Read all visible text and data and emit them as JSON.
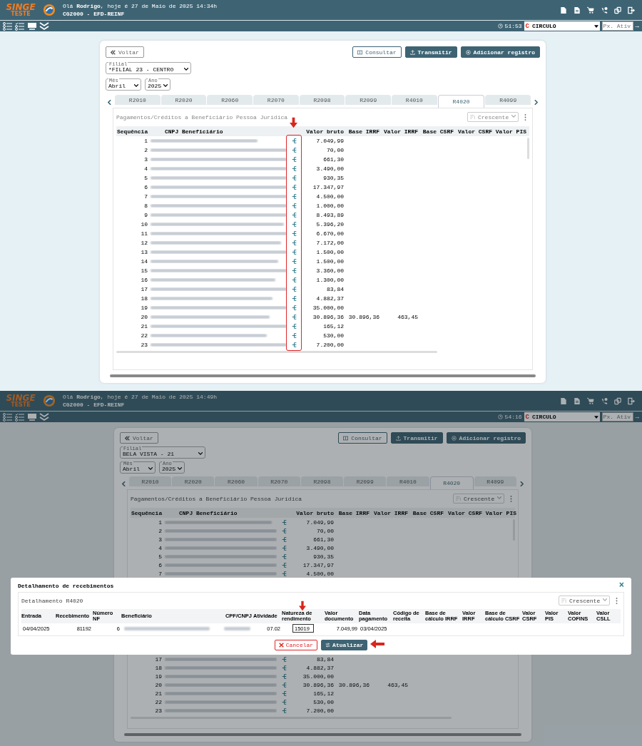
{
  "screens": [
    {
      "header": {
        "logo_top": "SINGE",
        "logo_bottom": "TESTE",
        "greeting": "Olá **Rodrigo**, hoje é 27 de Maio de 2025 14:34h",
        "module": "CG2000 - EFD-REINF"
      },
      "toolbar": {
        "session_time": "51:53",
        "company_logo": "C",
        "company": "CIRCULO",
        "field_placeholder": "Px. Ativ",
        "go": "→"
      },
      "back_button": "Voltar",
      "actions": [
        {
          "label": "Consultar",
          "kind": "outline"
        },
        {
          "label": "Transmitir",
          "kind": "upload"
        },
        {
          "label": "Adicionar registro",
          "kind": "add"
        }
      ],
      "filial": {
        "label": "Filial",
        "value": "*FILIAL 23 - CENTRO"
      },
      "mes": {
        "label": "Mês",
        "value": "Abril"
      },
      "ano": {
        "label": "Ano",
        "value": "2025"
      },
      "tabs": [
        {
          "label": "R2010",
          "selected": false
        },
        {
          "label": "R2020",
          "selected": false
        },
        {
          "label": "R2060",
          "selected": false
        },
        {
          "label": "R2070",
          "selected": false
        },
        {
          "label": "R2098",
          "selected": false
        },
        {
          "label": "R2099",
          "selected": false
        },
        {
          "label": "R4010",
          "selected": false
        },
        {
          "label": "R4020",
          "selected": true
        },
        {
          "label": "R4099",
          "selected": false
        }
      ],
      "panel": {
        "title": "Pagamentos/Créditos a Beneficiário Pessoa Jurídica",
        "sort": "Crescente",
        "columns": [
          "Sequência",
          "CNPJ Beneficiário",
          "Valor bruto",
          "Base IRRF",
          "Valor IRRF",
          "Base CSRF",
          "Valor CSRF",
          "Valor PIS"
        ],
        "rows": [
          {
            "seq": "1",
            "valor_bruto": "7.049,99"
          },
          {
            "seq": "2",
            "valor_bruto": "70,00"
          },
          {
            "seq": "3",
            "valor_bruto": "661,30"
          },
          {
            "seq": "4",
            "valor_bruto": "3.490,00"
          },
          {
            "seq": "5",
            "valor_bruto": "930,35"
          },
          {
            "seq": "6",
            "valor_bruto": "17.347,97"
          },
          {
            "seq": "7",
            "valor_bruto": "4.500,00"
          },
          {
            "seq": "8",
            "valor_bruto": "1.000,00"
          },
          {
            "seq": "9",
            "valor_bruto": "8.493,89"
          },
          {
            "seq": "10",
            "valor_bruto": "5.396,20"
          },
          {
            "seq": "11",
            "valor_bruto": "6.670,00"
          },
          {
            "seq": "12",
            "valor_bruto": "7.172,00"
          },
          {
            "seq": "13",
            "valor_bruto": "1.500,00"
          },
          {
            "seq": "14",
            "valor_bruto": "1.500,00"
          },
          {
            "seq": "15",
            "valor_bruto": "3.360,00"
          },
          {
            "seq": "16",
            "valor_bruto": "1.300,00"
          },
          {
            "seq": "17",
            "valor_bruto": "83,84"
          },
          {
            "seq": "18",
            "valor_bruto": "4.882,37"
          },
          {
            "seq": "19",
            "valor_bruto": "35.000,00"
          },
          {
            "seq": "20",
            "valor_bruto": "30.896,36",
            "base_irrf": "30.896,36",
            "valor_irrf": "463,45"
          },
          {
            "seq": "21",
            "valor_bruto": "165,12"
          },
          {
            "seq": "22",
            "valor_bruto": "530,00"
          },
          {
            "seq": "23",
            "valor_bruto": "7.200,00"
          }
        ]
      }
    },
    {
      "header": {
        "logo_top": "SINGE",
        "logo_bottom": "TESTE",
        "greeting": "Olá **Rodrigo**, hoje é 27 de Maio de 2025 14:49h",
        "module": "CG2000 - EFD-REINF"
      },
      "toolbar": {
        "session_time": "54:16",
        "company_logo": "C",
        "company": "CIRCULO",
        "field_placeholder": "Px. Ativ",
        "go": "→"
      },
      "back_button": "Voltar",
      "actions": [
        {
          "label": "Consultar",
          "kind": "outline"
        },
        {
          "label": "Transmitir",
          "kind": "upload"
        },
        {
          "label": "Adicionar registro",
          "kind": "add"
        }
      ],
      "filial": {
        "label": "Filial",
        "value": "BELA VISTA - 21"
      },
      "mes": {
        "label": "Mês",
        "value": "Abril"
      },
      "ano": {
        "label": "Ano",
        "value": "2025"
      },
      "tabs": [
        {
          "label": "R2010",
          "selected": false
        },
        {
          "label": "R2020",
          "selected": false
        },
        {
          "label": "R2060",
          "selected": false
        },
        {
          "label": "R2070",
          "selected": false
        },
        {
          "label": "R2098",
          "selected": false
        },
        {
          "label": "R2099",
          "selected": false
        },
        {
          "label": "R4010",
          "selected": false
        },
        {
          "label": "R4020",
          "selected": true
        },
        {
          "label": "R4099",
          "selected": false
        }
      ],
      "panel": {
        "title": "Pagamentos/Créditos a Beneficiário Pessoa Jurídica",
        "sort": "Crescente",
        "columns": [
          "Sequência",
          "CNPJ Beneficiário",
          "Valor bruto",
          "Base IRRF",
          "Valor IRRF",
          "Base CSRF",
          "Valor CSRF",
          "Valor PIS"
        ],
        "rows": [
          {
            "seq": "1",
            "valor_bruto": "7.049,99"
          },
          {
            "seq": "2",
            "valor_bruto": "70,00"
          },
          {
            "seq": "3",
            "valor_bruto": "661,30"
          },
          {
            "seq": "4",
            "valor_bruto": "3.490,00"
          },
          {
            "seq": "5",
            "valor_bruto": "930,35"
          },
          {
            "seq": "6",
            "valor_bruto": "17.347,97"
          },
          {
            "seq": "7",
            "valor_bruto": "4.500,00"
          }
        ],
        "rows_below_dialog": [
          {
            "seq": "17",
            "valor_bruto": "83,84"
          },
          {
            "seq": "18",
            "valor_bruto": "4.882,37"
          },
          {
            "seq": "19",
            "valor_bruto": "35.000,00"
          },
          {
            "seq": "20",
            "valor_bruto": "30.896,36",
            "base_irrf": "30.896,36",
            "valor_irrf": "463,45"
          },
          {
            "seq": "21",
            "valor_bruto": "165,12"
          },
          {
            "seq": "22",
            "valor_bruto": "530,00"
          },
          {
            "seq": "23",
            "valor_bruto": "7.200,00"
          }
        ]
      },
      "dialog": {
        "title": "Detalhamento de recebimentos",
        "close": "×",
        "panel_title": "Detalhamento R4020",
        "sort": "Crescente",
        "columns": [
          "Entrada",
          "Recebimento",
          "Número NF",
          "Beneficiário",
          "CPF/CNPJ",
          "Atividade",
          "Natureza de rendimento",
          "Valor documento",
          "Data pagamento",
          "Código de receita",
          "Base de cálculo IRRF",
          "Valor IRRF",
          "Base de cálculo CSRF",
          "Valor CSRF",
          "Valor PIS",
          "Valor COFINS",
          "Valor CSLL"
        ],
        "rows": [
          {
            "entrada": "04/04/2025",
            "recebimento": "81192",
            "numero_nf": "6",
            "atividade": "07.02",
            "natureza": "15019",
            "valor_documento": "7.049,99",
            "data_pagamento": "03/04/2025"
          }
        ],
        "buttons": [
          {
            "label": "Cancelar",
            "kind": "cancel"
          },
          {
            "label": "Atualizar",
            "kind": "refresh"
          }
        ]
      }
    }
  ]
}
